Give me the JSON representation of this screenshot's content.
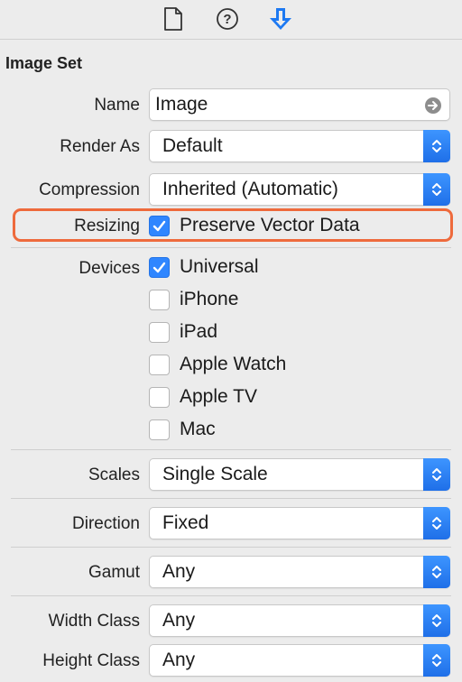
{
  "tabs": [
    {
      "icon": "file-icon"
    },
    {
      "icon": "help-icon"
    },
    {
      "icon": "attributes-inspector-icon"
    }
  ],
  "section_title": "Image Set",
  "name": {
    "label": "Name",
    "value": "Image"
  },
  "render_as": {
    "label": "Render As",
    "value": "Default"
  },
  "compression": {
    "label": "Compression",
    "value": "Inherited (Automatic)"
  },
  "resizing": {
    "label": "Resizing",
    "option": "Preserve Vector Data",
    "checked": true
  },
  "devices": {
    "label": "Devices",
    "items": [
      {
        "label": "Universal",
        "checked": true
      },
      {
        "label": "iPhone",
        "checked": false
      },
      {
        "label": "iPad",
        "checked": false
      },
      {
        "label": "Apple Watch",
        "checked": false
      },
      {
        "label": "Apple TV",
        "checked": false
      },
      {
        "label": "Mac",
        "checked": false
      }
    ]
  },
  "scales": {
    "label": "Scales",
    "value": "Single Scale"
  },
  "direction": {
    "label": "Direction",
    "value": "Fixed"
  },
  "gamut": {
    "label": "Gamut",
    "value": "Any"
  },
  "width_class": {
    "label": "Width Class",
    "value": "Any"
  },
  "height_class": {
    "label": "Height Class",
    "value": "Any"
  },
  "colors": {
    "accent": "#2f86ff",
    "highlight": "#ee6a3c"
  }
}
